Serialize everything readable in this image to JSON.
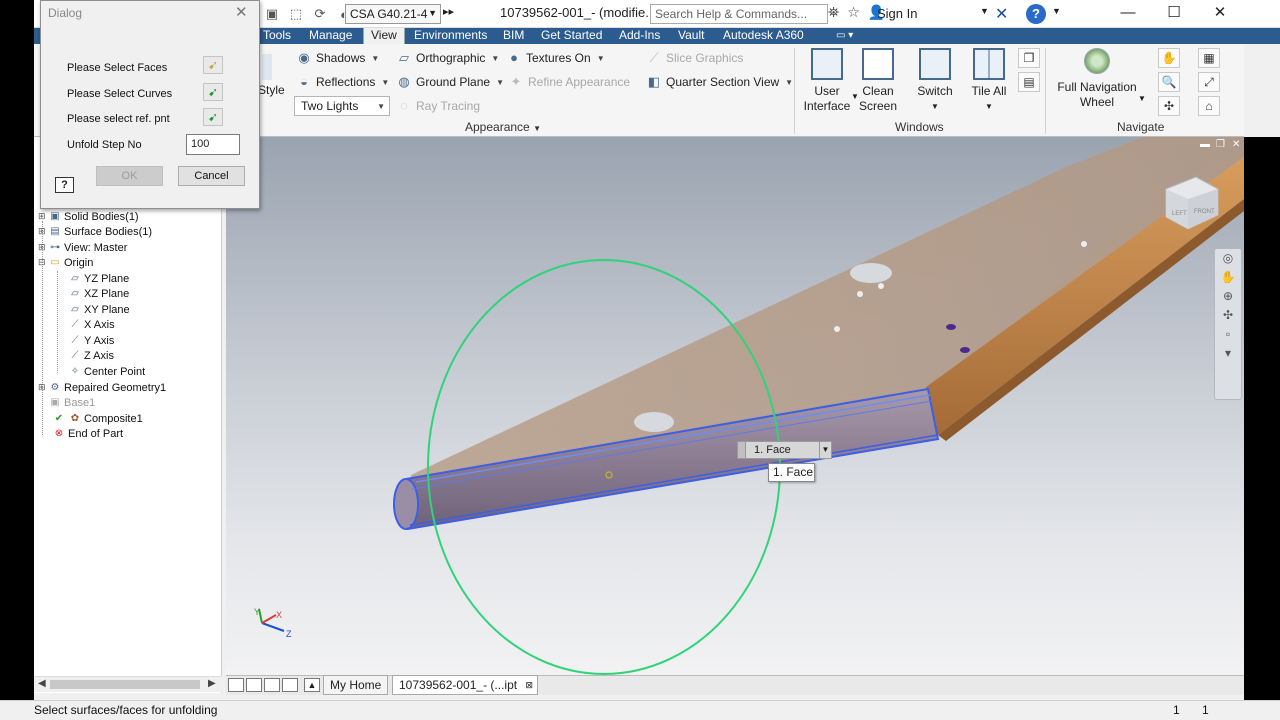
{
  "titlebar": {
    "material": "CSA G40.21-4",
    "document_title": "10739562-001_- (modifie...",
    "search_placeholder": "Search Help & Commands...",
    "sign_in": "Sign In"
  },
  "tabs": [
    {
      "label": "Tools",
      "active": false
    },
    {
      "label": "Manage",
      "active": false
    },
    {
      "label": "View",
      "active": true
    },
    {
      "label": "Environments",
      "active": false
    },
    {
      "label": "BIM",
      "active": false
    },
    {
      "label": "Get Started",
      "active": false
    },
    {
      "label": "Add-Ins",
      "active": false
    },
    {
      "label": "Vault",
      "active": false
    },
    {
      "label": "Autodesk A360",
      "active": false
    }
  ],
  "ribbon": {
    "style_label": "Style",
    "shadows": "Shadows",
    "reflections": "Reflections",
    "lighting_style": "Two Lights",
    "orthographic": "Orthographic",
    "ground_plane": "Ground Plane",
    "ray_tracing": "Ray Tracing",
    "textures_on": "Textures On",
    "refine_appearance": "Refine Appearance",
    "slice_graphics": "Slice Graphics",
    "quarter_section_view": "Quarter Section View",
    "appearance_panel": "Appearance",
    "user_interface_1": "User",
    "user_interface_2": "Interface",
    "clean_screen_1": "Clean",
    "clean_screen_2": "Screen",
    "switch": "Switch",
    "tile_all": "Tile All",
    "windows_panel": "Windows",
    "full_nav_wheel_1": "Full Navigation",
    "full_nav_wheel_2": "Wheel",
    "navigate_panel": "Navigate"
  },
  "browser": {
    "items": [
      {
        "label": "Solid Bodies(1)",
        "icon": "solid-bodies-icon"
      },
      {
        "label": "Surface Bodies(1)",
        "icon": "surface-bodies-icon"
      },
      {
        "label": "View: Master",
        "icon": "view-icon"
      },
      {
        "label": "Origin",
        "icon": "folder-icon"
      },
      {
        "label": "YZ Plane",
        "icon": "plane-icon"
      },
      {
        "label": "XZ Plane",
        "icon": "plane-icon"
      },
      {
        "label": "XY Plane",
        "icon": "plane-icon"
      },
      {
        "label": "X Axis",
        "icon": "axis-icon"
      },
      {
        "label": "Y Axis",
        "icon": "axis-icon"
      },
      {
        "label": "Z Axis",
        "icon": "axis-icon"
      },
      {
        "label": "Center Point",
        "icon": "point-icon"
      },
      {
        "label": "Repaired Geometry1",
        "icon": "repair-icon"
      },
      {
        "label": "Base1",
        "icon": "base-icon"
      },
      {
        "label": "Composite1",
        "icon": "composite-icon"
      },
      {
        "label": "End of Part",
        "icon": "end-of-part-icon"
      }
    ]
  },
  "dialog": {
    "title": "Dialog",
    "select_faces": "Please Select Faces",
    "select_curves": "Please Select Curves",
    "select_ref": "Please select ref. pnt",
    "unfold_step_label": "Unfold Step No",
    "unfold_step_value": "100",
    "help": "?",
    "ok": "OK",
    "cancel": "Cancel"
  },
  "canvas": {
    "selector_label": "1. Face",
    "tooltip": "1. Face",
    "triad_x": "X",
    "triad_y": "Y",
    "triad_z": "Z",
    "viewcube_front": "FRONT",
    "viewcube_left": "LEFT"
  },
  "doc_tabs": {
    "my_home": "My Home",
    "part": "10739562-001_- (...ipt"
  },
  "status": {
    "message": "Select surfaces/faces for unfolding",
    "count1": "1",
    "count2": "1"
  },
  "colors": {
    "tab_bar": "#2c5b8f",
    "plate": "#c7996a",
    "highlight": "#3c5fe6",
    "circle": "#2fd37a"
  }
}
